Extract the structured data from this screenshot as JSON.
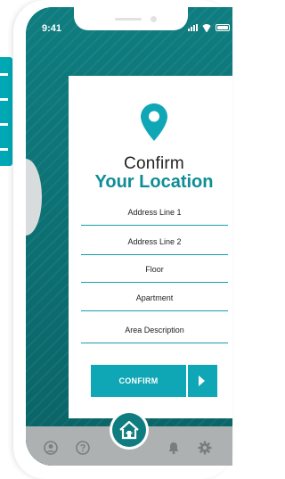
{
  "status_bar": {
    "time": "9:41"
  },
  "header": {
    "title_line1": "Confirm",
    "title_line2": "Your Location"
  },
  "form": {
    "fields": [
      {
        "label": "Address Line 1"
      },
      {
        "label": "Address Line 2"
      },
      {
        "label": "Floor"
      },
      {
        "label": "Apartment"
      },
      {
        "label": "Area Description"
      }
    ],
    "confirm_label": "CONFIRM"
  },
  "colors": {
    "teal_dark": "#0d6c6f",
    "teal_accent": "#0fa7b6",
    "title_teal": "#0e8d96",
    "tabbar_gray": "#aeb1b1"
  },
  "icons": {
    "location": "location-pin-icon",
    "arrow": "arrow-right-icon",
    "tabs": [
      "user-icon",
      "help-icon",
      "home-icon",
      "bell-icon",
      "gear-icon"
    ]
  }
}
